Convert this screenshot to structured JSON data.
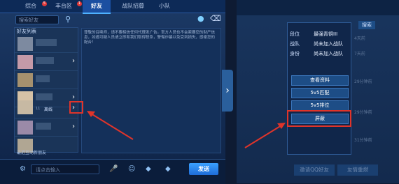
{
  "tabs": [
    "综合",
    "丰台区",
    "好友",
    "战队招募",
    "小队"
  ],
  "tab_badges": {
    "综合": "5",
    "丰台区": "1"
  },
  "search": {
    "placeholder": "搜索好友"
  },
  "friends_list": {
    "title": "好友列表",
    "highlighted_row_name": "离线",
    "highlighted_row_level": "11",
    "footer": "最近互动新朋友"
  },
  "notice": "尊敬的召唤师，请不要相信任何代理发广告。官方人员也不会索要您的财产信息，如遇可疑人员请立即和我们取得联系，警惕诈骗以免受到损失，感谢您的配合！",
  "chat": {
    "placeholder": "请点击输入",
    "send_label": "发送"
  },
  "popup": {
    "rows": [
      {
        "label": "段位",
        "value": "最强青铜III"
      },
      {
        "label": "战队",
        "value": "尚未加入战队"
      },
      {
        "label": "身份",
        "value": "尚未加入战队"
      }
    ],
    "buttons": [
      "查看资料",
      "5v5匹配",
      "5v5排位",
      "屏蔽"
    ]
  },
  "right_panel": {
    "search_label": "搜索",
    "side_times": [
      "4天前",
      "7天前",
      "29分钟前",
      "29分钟前",
      "31分钟前"
    ],
    "invite_label": "邀请QQ好友",
    "recruit_label": "友情重燃"
  },
  "colors": {
    "highlight": "#e0342a",
    "send_button": "#2b8cff"
  }
}
